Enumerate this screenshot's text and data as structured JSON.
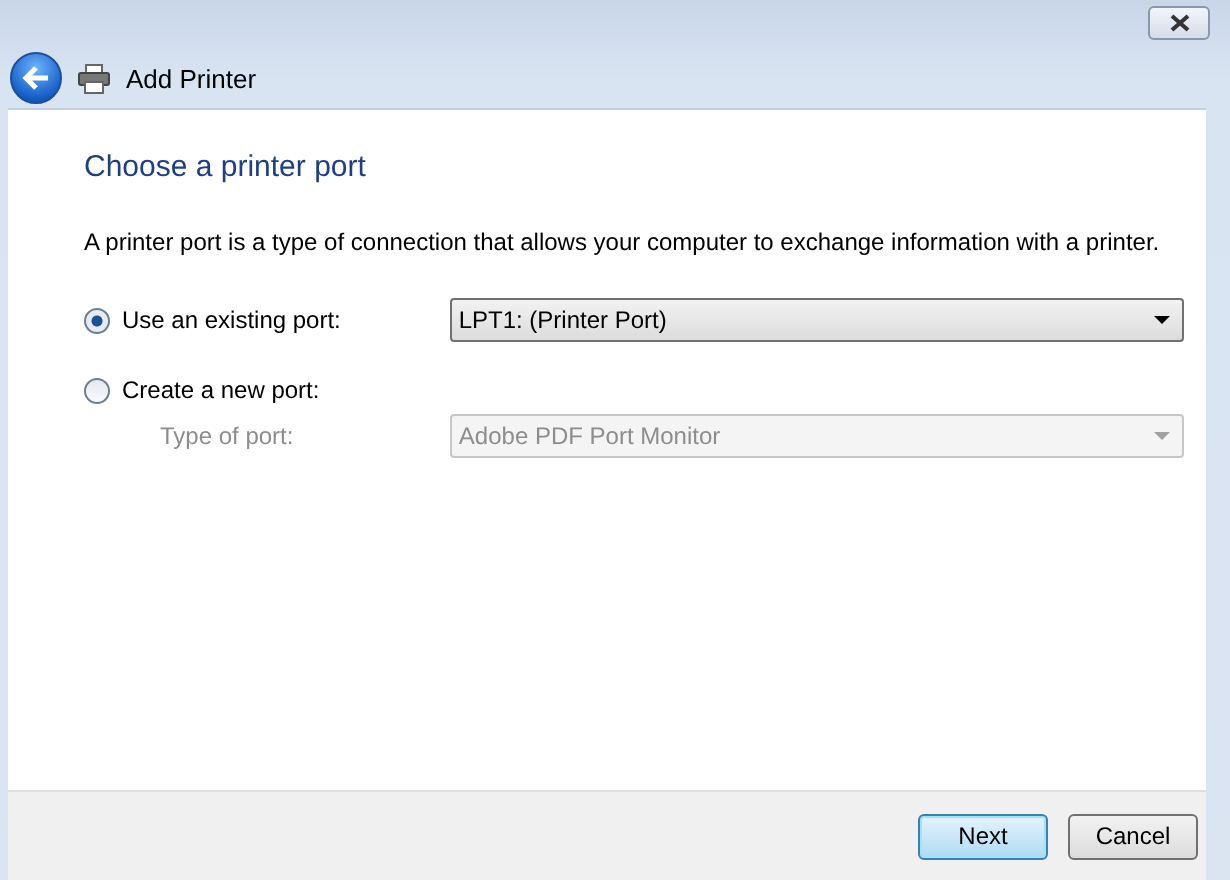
{
  "window": {
    "title": "Add Printer"
  },
  "heading": "Choose a printer port",
  "description": "A printer port is a type of connection that allows your computer to exchange information with a printer.",
  "options": [
    {
      "label": "Use an existing port:",
      "selected": true,
      "dropdown": {
        "value": "LPT1: (Printer Port)",
        "disabled": false
      }
    },
    {
      "label": "Create a new port:",
      "selected": false
    }
  ],
  "type_of_port": {
    "label": "Type of port:",
    "value": "Adobe PDF Port Monitor",
    "disabled": true
  },
  "buttons": [
    {
      "label": "Next",
      "default": true
    },
    {
      "label": "Cancel",
      "default": false
    }
  ]
}
